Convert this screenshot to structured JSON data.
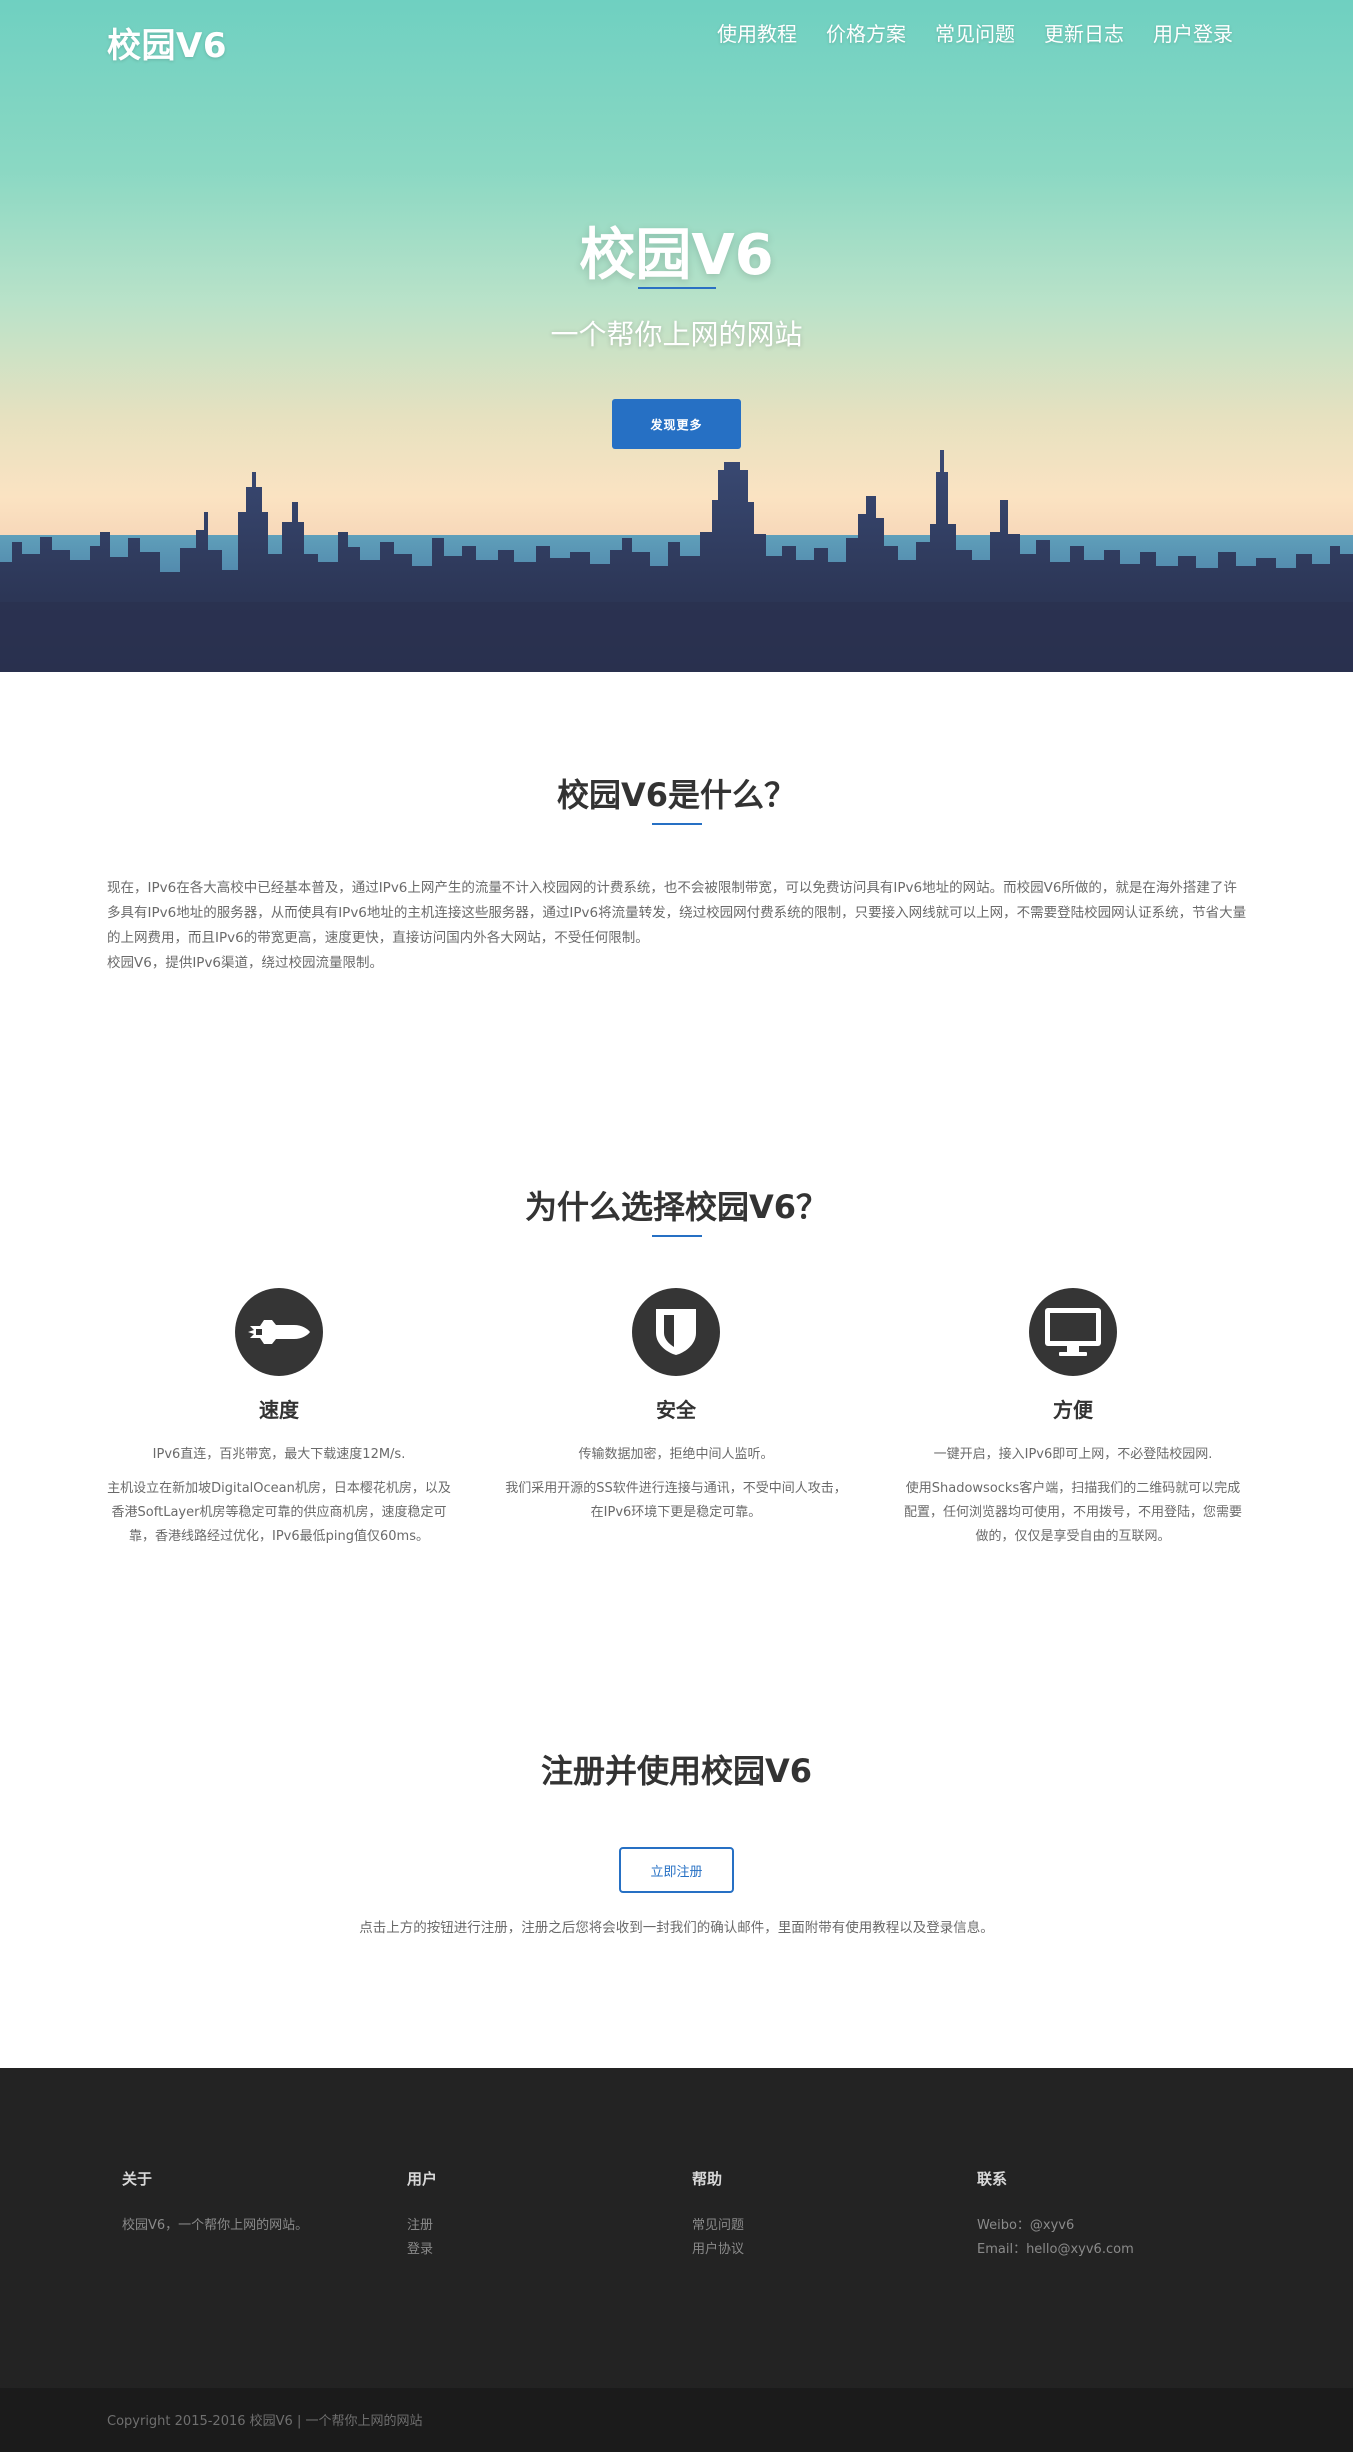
{
  "header": {
    "brand": "校园V6",
    "nav": [
      "使用教程",
      "价格方案",
      "常见问题",
      "更新日志",
      "用户登录"
    ]
  },
  "hero": {
    "title": "校园V6",
    "subtitle": "一个帮你上网的网站",
    "button_label": "发现更多"
  },
  "about": {
    "title": "校园V6是什么？",
    "paragraph1": "现在，IPv6在各大高校中已经基本普及，通过IPv6上网产生的流量不计入校园网的计费系统，也不会被限制带宽，可以免费访问具有IPv6地址的网站。而校园V6所做的，就是在海外搭建了许多具有IPv6地址的服务器，从而使具有IPv6地址的主机连接这些服务器，通过IPv6将流量转发，绕过校园网付费系统的限制，只要接入网线就可以上网，不需要登陆校园网认证系统，节省大量的上网费用，而且IPv6的带宽更高，速度更快，直接访问国内外各大网站，不受任何限制。",
    "paragraph2": "校园V6，提供IPv6渠道，绕过校园流量限制。"
  },
  "why": {
    "title": "为什么选择校园V6？",
    "features": [
      {
        "icon": "space-shuttle-icon",
        "title": "速度",
        "line1": "IPv6直连，百兆带宽，最大下载速度12M/s.",
        "line2": "主机设立在新加坡DigitalOcean机房，日本樱花机房，以及香港SoftLayer机房等稳定可靠的供应商机房，速度稳定可靠，香港线路经过优化，IPv6最低ping值仅60ms。"
      },
      {
        "icon": "shield-icon",
        "title": "安全",
        "line1": "传输数据加密，拒绝中间人监听。",
        "line2": "我们采用开源的SS软件进行连接与通讯，不受中间人攻击，在IPv6环境下更是稳定可靠。"
      },
      {
        "icon": "desktop-icon",
        "title": "方便",
        "line1": "一键开启，接入IPv6即可上网，不必登陆校园网.",
        "line2": "使用Shadowsocks客户端，扫描我们的二维码就可以完成配置，任何浏览器均可使用，不用拨号，不用登陆，您需要做的，仅仅是享受自由的互联网。"
      }
    ]
  },
  "register": {
    "title": "注册并使用校园V6",
    "button_label": "立即注册",
    "note": "点击上方的按钮进行注册，注册之后您将会收到一封我们的确认邮件，里面附带有使用教程以及登录信息。"
  },
  "footer": {
    "about": {
      "heading": "关于",
      "text": "校园V6，一个帮你上网的网站。"
    },
    "user": {
      "heading": "用户",
      "links": [
        "注册",
        "登录"
      ]
    },
    "help": {
      "heading": "帮助",
      "links": [
        "常见问题",
        "用户协议"
      ]
    },
    "contact": {
      "heading": "联系",
      "weibo": "Weibo：@xyv6",
      "email": "Email：hello@xyv6.com"
    },
    "copyright": "Copyright 2015-2016 校园V6 | 一个帮你上网的网站"
  },
  "colors": {
    "accent": "#2670c4",
    "footer_bg": "#232323",
    "copyright_bg": "#1b1b1b",
    "icon_circle": "#353535"
  }
}
